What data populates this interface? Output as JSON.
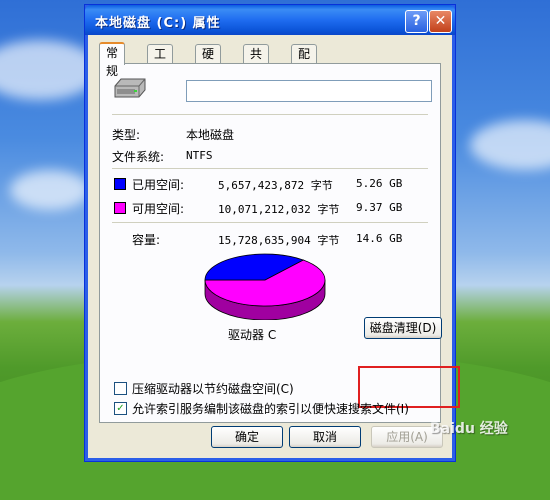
{
  "window": {
    "title": "本地磁盘 (C:) 属性",
    "help_glyph": "?",
    "close_glyph": "✕"
  },
  "tabs": [
    "常规",
    "工具",
    "硬件",
    "共享",
    "配额"
  ],
  "general": {
    "type_label": "类型:",
    "type_value": "本地磁盘",
    "fs_label": "文件系统:",
    "fs_value": "NTFS",
    "used_label": "已用空间:",
    "used_bytes": "5,657,423,872 字节",
    "used_gb": "5.26 GB",
    "free_label": "可用空间:",
    "free_bytes": "10,071,212,032 字节",
    "free_gb": "9.37 GB",
    "capacity_label": "容量:",
    "capacity_bytes": "15,728,635,904 字节",
    "capacity_gb": "14.6 GB",
    "drive_label": "驱动器 C",
    "cleanup_button": "磁盘清理(D)",
    "compress_checkbox": "压缩驱动器以节约磁盘空间(C)",
    "compress_checked": false,
    "index_checkbox": "允许索引服务编制该磁盘的索引以便快速搜索文件(I)",
    "index_checked": true
  },
  "colors": {
    "used": "#0000ff",
    "free": "#ff00ff"
  },
  "pie": {
    "used_fraction": 0.36,
    "free_fraction": 0.64
  },
  "footer": {
    "ok": "确定",
    "cancel": "取消",
    "apply": "应用(A)"
  },
  "watermark": "Baidu 经验"
}
